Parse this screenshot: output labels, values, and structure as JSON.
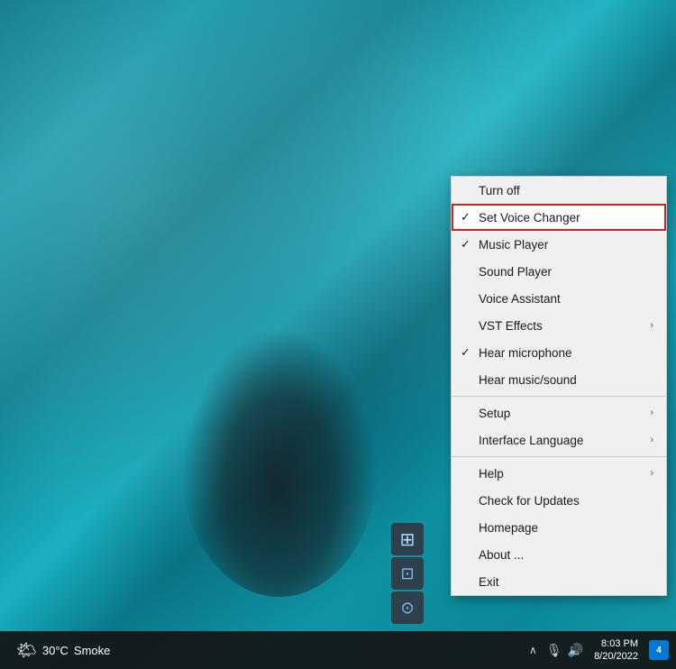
{
  "desktop": {
    "bg_alt": "Underwater scene with elephant"
  },
  "taskbar": {
    "weather_icon": "🌤",
    "temperature": "30°C",
    "condition": "Smoke",
    "chevron": "∧",
    "mic_icon": "🎙",
    "volume_icon": "🔊",
    "time": "8:03 PM",
    "date": "8/20/2022",
    "notification_count": "4"
  },
  "tray_icons": [
    {
      "id": "tray-1",
      "icon": "⊞",
      "label": "tray icon 1"
    },
    {
      "id": "tray-2",
      "icon": "⊡",
      "label": "tray icon 2"
    },
    {
      "id": "tray-3",
      "icon": "⊙",
      "label": "tray icon 3"
    }
  ],
  "context_menu": {
    "items": [
      {
        "id": "turn-off",
        "check": "",
        "label": "Turn off",
        "arrow": "",
        "separator_after": false,
        "highlighted": false
      },
      {
        "id": "set-voice-changer",
        "check": "✓",
        "label": "Set Voice Changer",
        "arrow": "",
        "separator_after": false,
        "highlighted": true
      },
      {
        "id": "music-player",
        "check": "✓",
        "label": "Music Player",
        "arrow": "",
        "separator_after": false,
        "highlighted": false
      },
      {
        "id": "sound-player",
        "check": "",
        "label": "Sound Player",
        "arrow": "",
        "separator_after": false,
        "highlighted": false
      },
      {
        "id": "voice-assistant",
        "check": "",
        "label": "Voice Assistant",
        "arrow": "",
        "separator_after": false,
        "highlighted": false
      },
      {
        "id": "vst-effects",
        "check": "",
        "label": "VST Effects",
        "arrow": "›",
        "separator_after": false,
        "highlighted": false
      },
      {
        "id": "hear-microphone",
        "check": "✓",
        "label": "Hear microphone",
        "arrow": "",
        "separator_after": false,
        "highlighted": false
      },
      {
        "id": "hear-music-sound",
        "check": "",
        "label": "Hear music/sound",
        "arrow": "",
        "separator_after": true,
        "highlighted": false
      },
      {
        "id": "setup",
        "check": "",
        "label": "Setup",
        "arrow": "›",
        "separator_after": false,
        "highlighted": false
      },
      {
        "id": "interface-language",
        "check": "",
        "label": "Interface Language",
        "arrow": "›",
        "separator_after": true,
        "highlighted": false
      },
      {
        "id": "help",
        "check": "",
        "label": "Help",
        "arrow": "›",
        "separator_after": false,
        "highlighted": false
      },
      {
        "id": "check-for-updates",
        "check": "",
        "label": "Check for Updates",
        "arrow": "",
        "separator_after": false,
        "highlighted": false
      },
      {
        "id": "homepage",
        "check": "",
        "label": "Homepage",
        "arrow": "",
        "separator_after": false,
        "highlighted": false
      },
      {
        "id": "about",
        "check": "",
        "label": "About ...",
        "arrow": "",
        "separator_after": false,
        "highlighted": false
      },
      {
        "id": "exit",
        "check": "",
        "label": "Exit",
        "arrow": "",
        "separator_after": false,
        "highlighted": false
      }
    ]
  }
}
